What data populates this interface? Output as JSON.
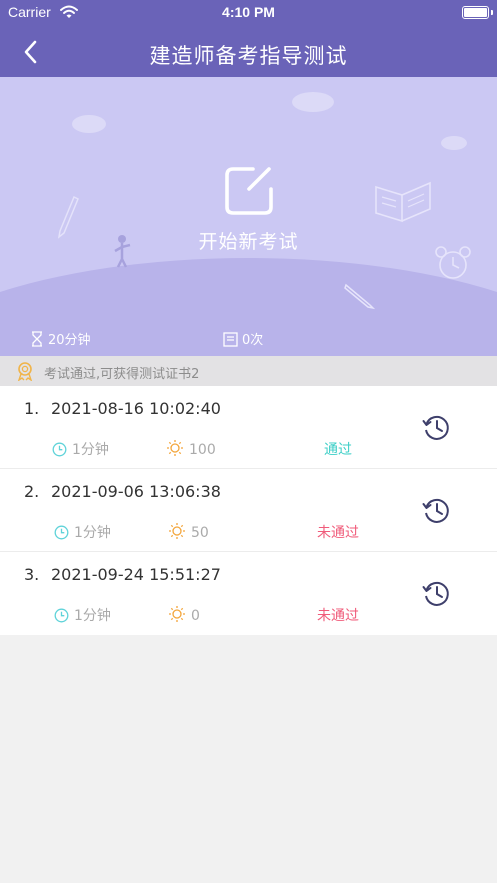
{
  "status_bar": {
    "carrier": "Carrier",
    "time": "4:10 PM"
  },
  "nav": {
    "title": "建造师备考指导测试",
    "back_icon": "chevron-left-icon"
  },
  "hero": {
    "start_label": "开始新考试",
    "duration": "20分钟",
    "attempts": "0次"
  },
  "notice": {
    "text": "考试通过,可获得测试证书2"
  },
  "records": [
    {
      "index": "1.",
      "datetime": "2021-08-16 10:02:40",
      "duration": "1分钟",
      "score": "100",
      "status": "通过"
    },
    {
      "index": "2.",
      "datetime": "2021-09-06 13:06:38",
      "duration": "1分钟",
      "score": "50",
      "status": "未通过"
    },
    {
      "index": "3.",
      "datetime": "2021-09-24 15:51:27",
      "duration": "1分钟",
      "score": "0",
      "status": "未通过"
    }
  ],
  "colors": {
    "header": "#6a63b8",
    "hero": "#cbc8f3",
    "pass": "#3dcfc7",
    "fail": "#f05b7a",
    "clock": "#5fd3d9",
    "score_icon": "#f3a53a",
    "history_icon": "#3e3f6b"
  }
}
